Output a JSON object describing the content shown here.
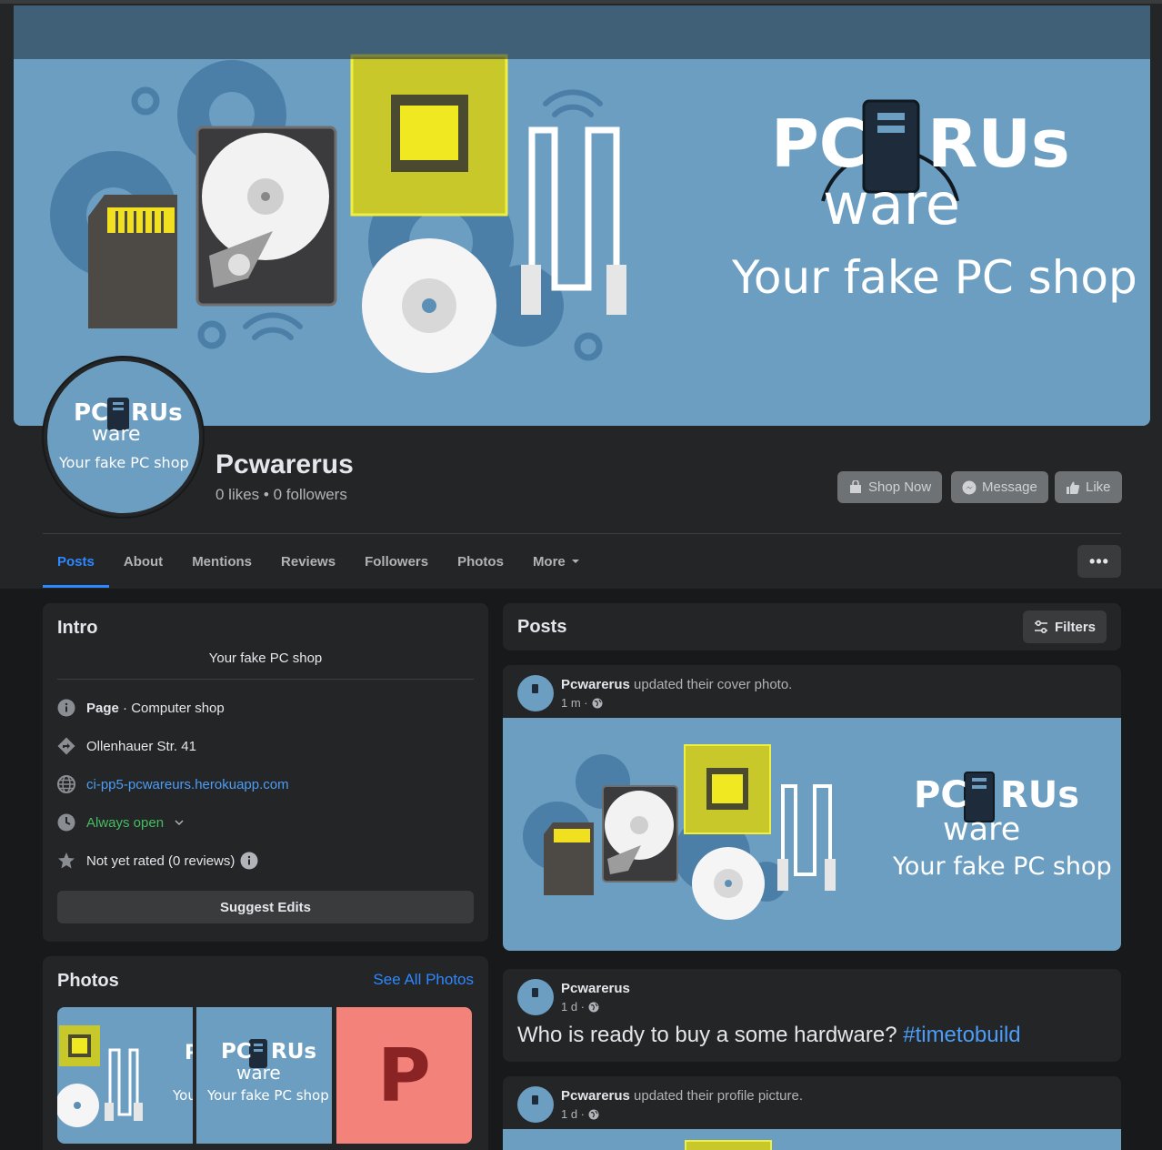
{
  "cover": {
    "brand_pc": "PC",
    "brand_rus": "RUs",
    "brand_ware": "ware",
    "tagline": "Your fake PC shop"
  },
  "page": {
    "name": "Pcwarerus",
    "stats": "0 likes • 0 followers"
  },
  "header_buttons": {
    "shop_now": "Shop Now",
    "message": "Message",
    "like": "Like"
  },
  "tabs": [
    {
      "label": "Posts",
      "active": true
    },
    {
      "label": "About"
    },
    {
      "label": "Mentions"
    },
    {
      "label": "Reviews"
    },
    {
      "label": "Followers"
    },
    {
      "label": "Photos"
    },
    {
      "label": "More"
    }
  ],
  "more_menu": "•••",
  "intro": {
    "title": "Intro",
    "bio": "Your fake PC shop",
    "category_bold": "Page",
    "category_rest": " · Computer shop",
    "address": "Ollenhauer Str. 41",
    "website": "ci-pp5-pcwareurs.herokuapp.com",
    "hours": "Always open",
    "rating": "Not yet rated (0 reviews)",
    "suggest_button": "Suggest Edits"
  },
  "photos": {
    "title": "Photos",
    "see_all": "See All Photos",
    "thumb2_pc": "PC",
    "thumb2_rus": "RUs",
    "thumb2_ware": "ware",
    "thumb2_tagline": "Your fake PC shop",
    "thumb1_letter": "P",
    "thumb1_you": "You",
    "thumb3_letter": "P"
  },
  "posts": {
    "title": "Posts",
    "filters": "Filters",
    "items": [
      {
        "author": "Pcwarerus",
        "action": " updated their cover photo.",
        "time": "1 m ·"
      },
      {
        "author": "Pcwarerus",
        "action": "",
        "time": "1 d ·",
        "text": "Who is ready to buy a some hardware? ",
        "hashtag": "#timetobuild"
      },
      {
        "author": "Pcwarerus",
        "action": " updated their profile picture.",
        "time": "1 d ·"
      }
    ],
    "avatar_pc": "PC",
    "avatar_rus": "RUs",
    "avatar_ware": "ware",
    "avatar_tagline": "Your fake PC shop"
  },
  "colors": {
    "accent": "#2d88ff",
    "cover_blue": "#6c9ec2",
    "open_green": "#45bd62",
    "thumb_red": "#f2827a",
    "thumb_letter": "#8a2424"
  }
}
